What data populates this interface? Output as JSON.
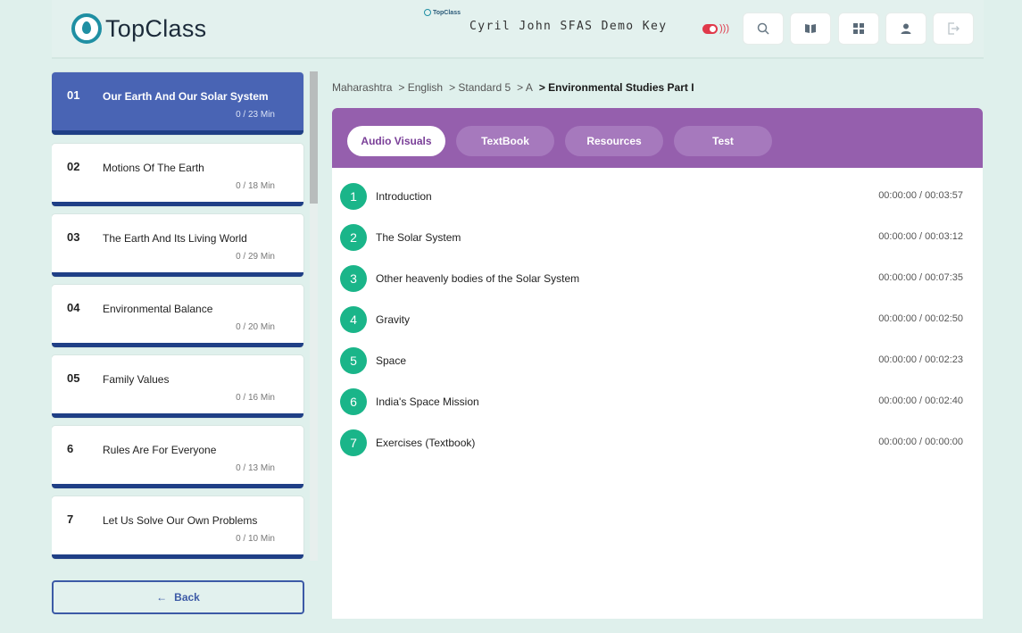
{
  "header": {
    "logo_text": "TopClass",
    "mini_brand": "TopClass",
    "user_key": "Cyril John SFAS Demo Key",
    "buttons": [
      "search",
      "book",
      "grid",
      "profile",
      "logout"
    ]
  },
  "sidebar": {
    "chapters": [
      {
        "num": "01",
        "title": "Our Earth And Our Solar System",
        "duration": "0 / 23 Min",
        "active": true
      },
      {
        "num": "02",
        "title": "Motions Of The Earth",
        "duration": "0 / 18 Min"
      },
      {
        "num": "03",
        "title": "The Earth And Its Living World",
        "duration": "0 / 29 Min"
      },
      {
        "num": "04",
        "title": "Environmental Balance",
        "duration": "0 / 20 Min"
      },
      {
        "num": "05",
        "title": "Family Values",
        "duration": "0 / 16 Min"
      },
      {
        "num": "6",
        "title": "Rules Are For Everyone",
        "duration": "0 / 13 Min"
      },
      {
        "num": "7",
        "title": "Let Us Solve Our Own Problems",
        "duration": "0 / 10 Min"
      }
    ],
    "back_label": "Back"
  },
  "breadcrumb": [
    "Maharashtra",
    "> English",
    "> Standard 5",
    "> A",
    "> Environmental Studies Part I"
  ],
  "tabs": [
    {
      "label": "Audio Visuals",
      "active": true
    },
    {
      "label": "TextBook"
    },
    {
      "label": "Resources"
    },
    {
      "label": "Test"
    }
  ],
  "lessons": [
    {
      "num": "1",
      "name": "Introduction",
      "time": "00:00:00 / 00:03:57"
    },
    {
      "num": "2",
      "name": "The Solar System",
      "time": "00:00:00 / 00:03:12"
    },
    {
      "num": "3",
      "name": "Other heavenly bodies of the Solar System",
      "time": "00:00:00 / 00:07:35"
    },
    {
      "num": "4",
      "name": "Gravity",
      "time": "00:00:00 / 00:02:50"
    },
    {
      "num": "5",
      "name": "Space",
      "time": "00:00:00 / 00:02:23"
    },
    {
      "num": "6",
      "name": "India's Space Mission",
      "time": "00:00:00 / 00:02:40"
    },
    {
      "num": "7",
      "name": "Exercises (Textbook)",
      "time": "00:00:00 / 00:00:00"
    }
  ],
  "colors": {
    "accent_purple": "#955fad",
    "active_chapter": "#4964b4",
    "lesson_badge": "#1ab589",
    "record_indicator": "#e0394a"
  }
}
